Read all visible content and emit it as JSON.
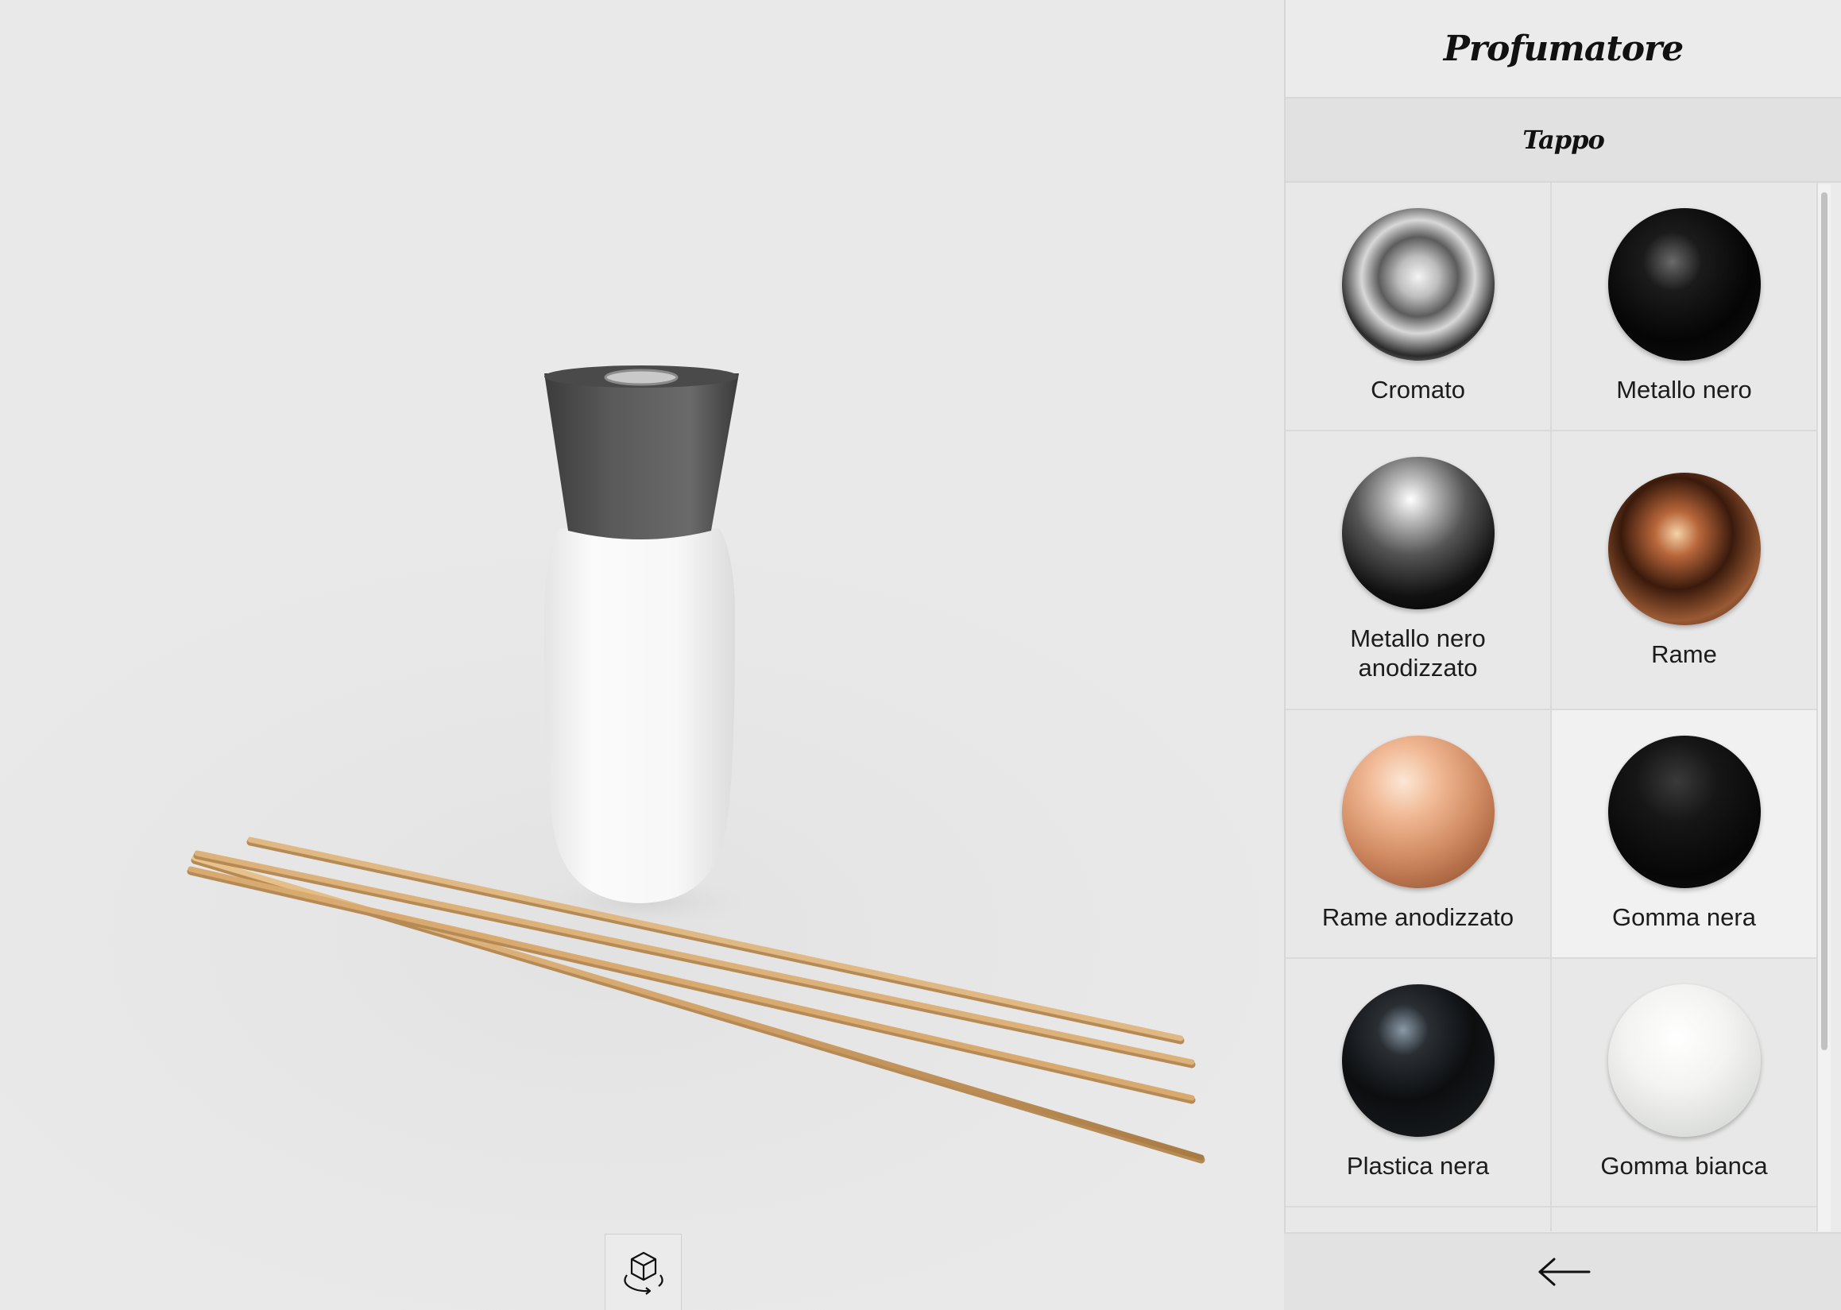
{
  "panel": {
    "title": "Profumatore",
    "section": "Tappo"
  },
  "materials": [
    {
      "label": "Cromato",
      "selected": false
    },
    {
      "label": "Metallo nero",
      "selected": false
    },
    {
      "label": "Metallo nero anodizzato",
      "selected": false
    },
    {
      "label": "Rame",
      "selected": false
    },
    {
      "label": "Rame anodizzato",
      "selected": false
    },
    {
      "label": "Gomma nera",
      "selected": true
    },
    {
      "label": "Plastica nera",
      "selected": false
    },
    {
      "label": "Gomma bianca",
      "selected": false
    }
  ],
  "icons": {
    "ar_view": "cube-rotate-icon",
    "back": "arrow-left-icon"
  },
  "colors": {
    "background": "#e8e8e8",
    "panel": "#ebebeb",
    "reed": "#d4a872",
    "cap": "#505050",
    "bottle": "#f7f7f7"
  }
}
